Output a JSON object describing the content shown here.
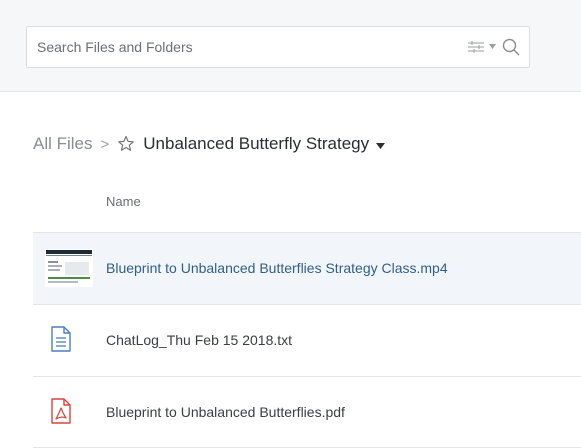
{
  "search": {
    "placeholder": "Search Files and Folders"
  },
  "breadcrumb": {
    "root": "All Files",
    "separator": ">",
    "current": "Unbalanced Butterfly Strategy"
  },
  "table": {
    "column_name": "Name",
    "files": [
      {
        "name": "Blueprint to Unbalanced Butterflies Strategy Class.mp4",
        "type": "video",
        "selected": true
      },
      {
        "name": "ChatLog_Thu Feb 15 2018.txt",
        "type": "text",
        "selected": false
      },
      {
        "name": "Blueprint to Unbalanced Butterflies.pdf",
        "type": "pdf",
        "selected": false
      }
    ]
  },
  "colors": {
    "link_blue": "#2f5f8a",
    "doc_blue": "#4a7fc1",
    "pdf_red": "#d9453b",
    "topbar_bg": "#f6f7f8"
  },
  "icons": {
    "filter": "sliders-icon",
    "search": "magnifier-icon",
    "star": "star-outline-icon"
  }
}
